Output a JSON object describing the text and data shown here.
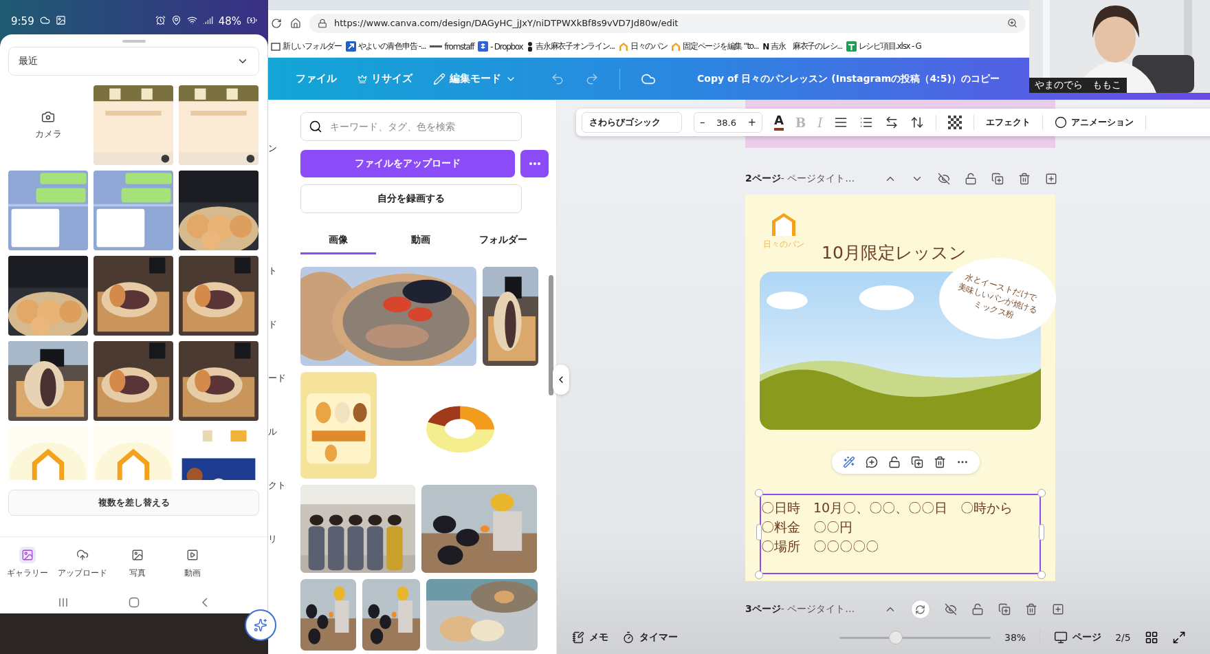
{
  "phone": {
    "time": "9:59",
    "battery": "48%",
    "album": "最近",
    "gallery": [
      {
        "kind": "camera",
        "label": "カメラ"
      },
      {
        "kind": "picture"
      },
      {
        "kind": "picture"
      },
      {
        "kind": "picture"
      },
      {
        "kind": "picture"
      },
      {
        "kind": "picture"
      },
      {
        "kind": "picture"
      },
      {
        "kind": "picture"
      },
      {
        "kind": "picture"
      },
      {
        "kind": "picture"
      },
      {
        "kind": "picture"
      },
      {
        "kind": "picture"
      },
      {
        "kind": "picture"
      },
      {
        "kind": "picture"
      },
      {
        "kind": "picture"
      }
    ],
    "replace_button": "複数を差し替える",
    "nav": [
      {
        "label": "ギャラリー",
        "selected": true
      },
      {
        "label": "アップロード",
        "selected": false
      },
      {
        "label": "写真",
        "selected": false
      },
      {
        "label": "動画",
        "selected": false
      }
    ]
  },
  "browser": {
    "url": "https://www.canva.com/design/DAGyHC_jJxY/niDTPWXkBf8s9vVD7Jd80w/edit",
    "bookmarks": [
      {
        "kind": "folder",
        "label": "新しいフォルダー"
      },
      {
        "kind": "arrow",
        "label": "やよいの青色申告 -..."
      },
      {
        "kind": "line",
        "label": "fromstaff"
      },
      {
        "kind": "box",
        "label": "- Dropbox"
      },
      {
        "kind": "person",
        "label": "吉永麻衣子オンライン..."
      },
      {
        "kind": "house",
        "label": "日々のパン"
      },
      {
        "kind": "house",
        "label": "固定ページを編集 “to..."
      },
      {
        "kind": "letter",
        "glyph": "N",
        "label": "吉永　麻衣子のレシ..."
      },
      {
        "kind": "sheet",
        "label": "レシピ項目.xlsx - G"
      }
    ]
  },
  "canva_header": {
    "file": "ファイル",
    "resize": "リサイズ",
    "mode": "編集モード",
    "title": "Copy of 日々のパンレッスン (Instagramの投稿（4:5)）のコピー"
  },
  "webcam": {
    "name": "やまのでら　ももこ"
  },
  "side_rail": [
    "ン",
    "ト",
    "ド",
    "ード",
    "ル",
    "クト",
    "リ"
  ],
  "uploads_panel": {
    "search_placeholder": "キーワード、タグ、色を検索",
    "upload_button": "ファイルをアップロード",
    "record_button": "自分を録画する",
    "tabs": [
      {
        "label": "画像",
        "selected": true
      },
      {
        "label": "動画",
        "selected": false
      },
      {
        "label": "フォルダー",
        "selected": false
      }
    ],
    "images": [
      {
        "kind": "picture"
      },
      {
        "kind": "picture"
      },
      {
        "kind": "picture"
      },
      {
        "kind": "picture"
      },
      {
        "kind": "picture"
      },
      {
        "kind": "picture"
      },
      {
        "kind": "picture"
      },
      {
        "kind": "picture"
      },
      {
        "kind": "picture"
      }
    ]
  },
  "text_toolbar": {
    "font": "さわらびゴシック",
    "minus": "–",
    "size": "38.6",
    "plus": "+",
    "color_glyph": "A",
    "styles": [
      {
        "glyph": "B",
        "disabled": true
      },
      {
        "glyph": "I",
        "disabled": true
      }
    ],
    "effects": "エフェクト",
    "animation": "アニメーション"
  },
  "pages": [
    {
      "number": "2ページ",
      "title": " - ページタイト…"
    },
    {
      "number": "3ページ",
      "title": " - ページタイト…"
    }
  ],
  "design": {
    "logo_text": "日々のパン",
    "heading": "10月限定レッスン",
    "bubble_lines": [
      "水とイーストだけで",
      "美味しいパンが焼ける",
      "ミックス粉"
    ],
    "details": [
      "〇日時　10月〇、〇〇、〇〇日　〇時から",
      "〇料金　〇〇円",
      "〇場所　〇〇〇〇〇"
    ]
  },
  "footer": {
    "notes": "メモ",
    "timer": "タイマー",
    "zoom": {
      "level": 0.36,
      "reading": "38%"
    },
    "pages_button": "ページ",
    "page_count": "2/5"
  }
}
